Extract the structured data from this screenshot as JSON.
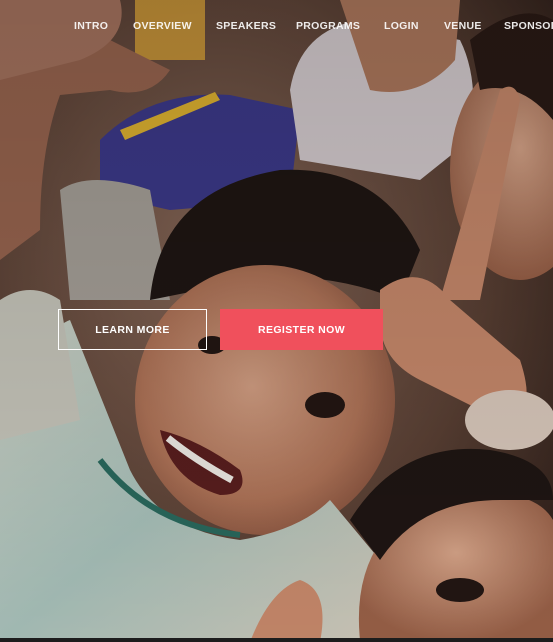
{
  "nav": {
    "items": [
      {
        "label": "INTRO"
      },
      {
        "label": "OVERVIEW"
      },
      {
        "label": "SPEAKERS"
      },
      {
        "label": "PROGRAMS"
      },
      {
        "label": "LOGIN"
      },
      {
        "label": "VENUE"
      },
      {
        "label": "SPONSORS"
      }
    ]
  },
  "hero": {
    "learn_more_label": "LEARN MORE",
    "register_label": "REGISTER NOW"
  },
  "colors": {
    "accent": "#f0505c",
    "nav_text": "#ffffff",
    "outline": "#ffffff"
  }
}
